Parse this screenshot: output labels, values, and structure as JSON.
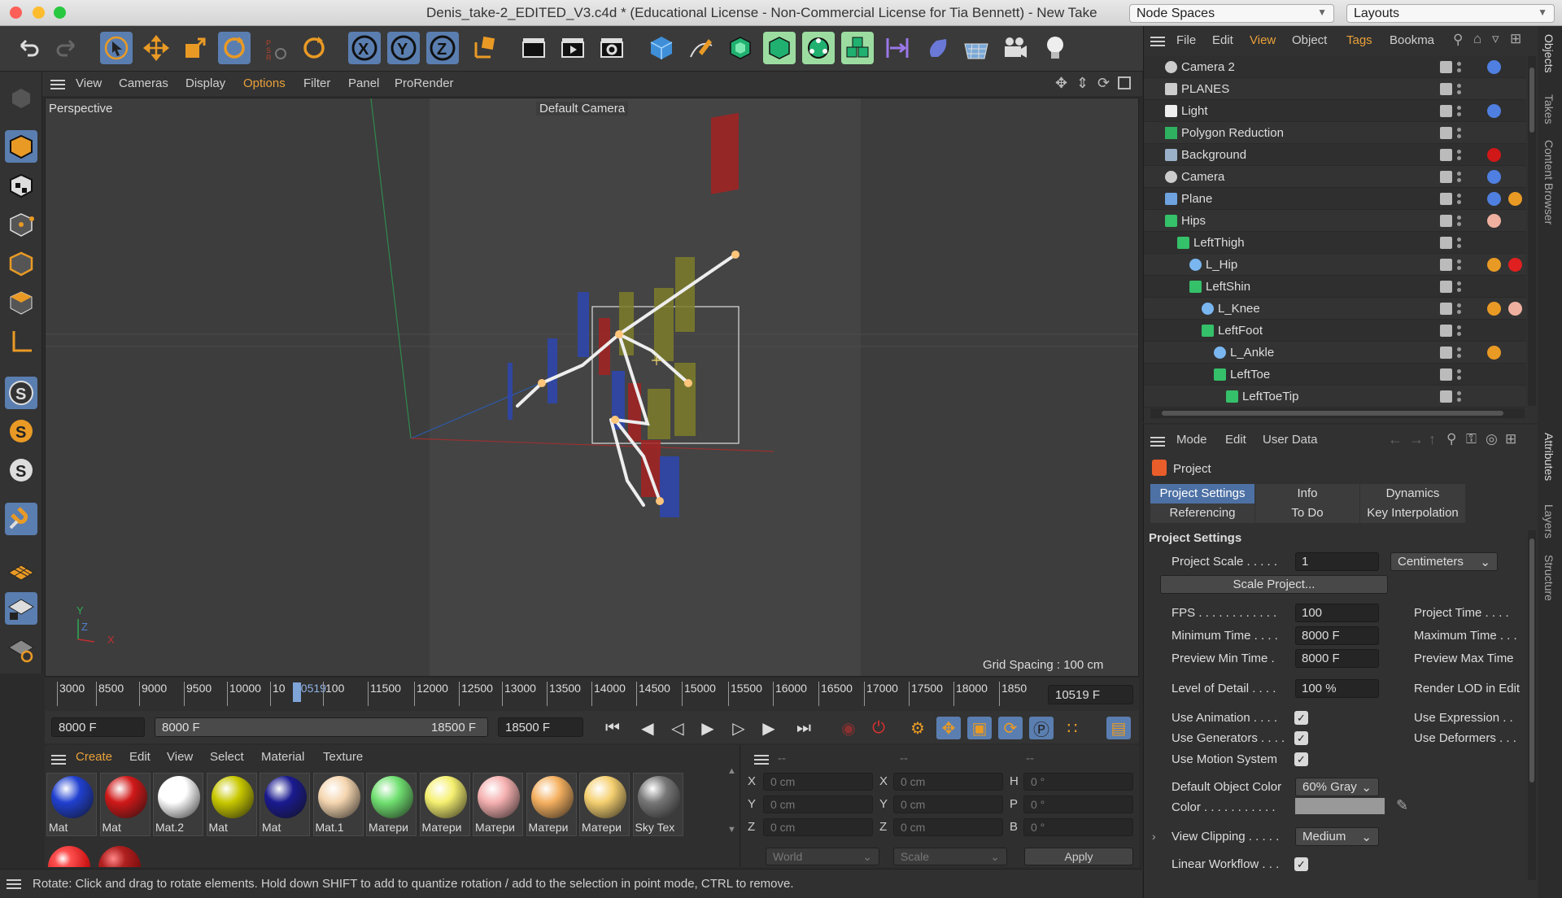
{
  "window": {
    "title": "Denis_take-2_EDITED_V3.c4d * (Educational License - Non-Commercial License for Tia Bennett) - New Take",
    "node_spaces": "Node Spaces",
    "layouts": "Layouts"
  },
  "viewport_menu": {
    "items": [
      "View",
      "Cameras",
      "Display",
      "Options",
      "Filter",
      "Panel",
      "ProRender"
    ],
    "active": "Options"
  },
  "viewport": {
    "label": "Perspective",
    "camera": "Default Camera",
    "grid_spacing": "Grid Spacing : 100 cm",
    "axis": {
      "x": "X",
      "y": "Y",
      "z": "Z"
    }
  },
  "timeline": {
    "ticks": [
      "3000",
      "8500",
      "9000",
      "9500",
      "10000",
      "10",
      "10519",
      "100",
      "11500",
      "12000",
      "12500",
      "13000",
      "13500",
      "14000",
      "14500",
      "15000",
      "15500",
      "16000",
      "16500",
      "17000",
      "17500",
      "18000",
      "1850"
    ],
    "current": "10519 F"
  },
  "playbar": {
    "start": "8000 F",
    "range_start": "8000 F",
    "range_end": "18500 F",
    "end": "18500 F"
  },
  "material_menu": {
    "items": [
      "Create",
      "Edit",
      "View",
      "Select",
      "Material",
      "Texture"
    ],
    "active": "Create"
  },
  "materials": [
    {
      "name": "Mat",
      "color": "#2040d0"
    },
    {
      "name": "Mat",
      "color": "#d01818"
    },
    {
      "name": "Mat.2",
      "color": "#ffffff"
    },
    {
      "name": "Mat",
      "color": "#c8c800"
    },
    {
      "name": "Mat",
      "color": "#1a1a90"
    },
    {
      "name": "Mat.1",
      "color": "#f5d6b0"
    },
    {
      "name": "Матери",
      "color": "#70e070"
    },
    {
      "name": "Матери",
      "color": "#f5f070"
    },
    {
      "name": "Матери",
      "color": "#f5b0b0"
    },
    {
      "name": "Матери",
      "color": "#f5b060"
    },
    {
      "name": "Матери",
      "color": "#f5d070"
    },
    {
      "name": "Sky Tex",
      "color": "#777777"
    }
  ],
  "coords": {
    "header": [
      "--",
      "--",
      "--"
    ],
    "rows": [
      {
        "a": "X",
        "av": "0 cm",
        "b": "X",
        "bv": "0 cm",
        "c": "H",
        "cv": "0 °"
      },
      {
        "a": "Y",
        "av": "0 cm",
        "b": "Y",
        "bv": "0 cm",
        "c": "P",
        "cv": "0 °"
      },
      {
        "a": "Z",
        "av": "0 cm",
        "b": "Z",
        "bv": "0 cm",
        "c": "B",
        "cv": "0 °"
      }
    ],
    "world": "World",
    "scale": "Scale",
    "apply": "Apply"
  },
  "status": "Rotate: Click and drag to rotate elements. Hold down SHIFT to add to quantize rotation / add to the selection in point mode, CTRL to remove.",
  "object_menu": {
    "items": [
      "File",
      "Edit",
      "View",
      "Object",
      "Tags",
      "Bookma"
    ]
  },
  "objects": [
    {
      "name": "Camera 2",
      "depth": 0
    },
    {
      "name": "PLANES",
      "depth": 0
    },
    {
      "name": "Light",
      "depth": 0
    },
    {
      "name": "Polygon Reduction",
      "depth": 0
    },
    {
      "name": "Background",
      "depth": 0
    },
    {
      "name": "Camera",
      "depth": 0
    },
    {
      "name": "Plane",
      "depth": 0
    },
    {
      "name": "Hips",
      "depth": 0
    },
    {
      "name": "LeftThigh",
      "depth": 1
    },
    {
      "name": "L_Hip",
      "depth": 2
    },
    {
      "name": "LeftShin",
      "depth": 2
    },
    {
      "name": "L_Knee",
      "depth": 3
    },
    {
      "name": "LeftFoot",
      "depth": 3
    },
    {
      "name": "L_Ankle",
      "depth": 4
    },
    {
      "name": "LeftToe",
      "depth": 4
    },
    {
      "name": "LeftToeTip",
      "depth": 5
    }
  ],
  "attr_menu": {
    "items": [
      "Mode",
      "Edit",
      "User Data"
    ]
  },
  "attributes": {
    "heading": "Project",
    "tabs": [
      "Project Settings",
      "Info",
      "Dynamics",
      "Referencing",
      "To Do",
      "Key Interpolation"
    ],
    "section": "Project Settings",
    "project_scale_label": "Project Scale . . . . .",
    "project_scale": "1",
    "units": "Centimeters",
    "scale_project": "Scale Project...",
    "fps_label": "FPS . . . . . . . . . . . .",
    "fps": "100",
    "project_time": "Project Time . . . .",
    "min_time_label": "Minimum Time . . . .",
    "min_time": "8000 F",
    "max_time": "Maximum Time . . .",
    "prev_min_label": "Preview Min Time .",
    "prev_min": "8000 F",
    "prev_max": "Preview Max Time",
    "lod_label": "Level of Detail . . . .",
    "lod": "100 %",
    "render_lod": "Render LOD in Edit",
    "use_animation": "Use Animation . . . .",
    "use_expression": "Use Expression . .",
    "use_generators": "Use Generators . . . .",
    "use_deformers": "Use Deformers . . .",
    "use_motion": "Use Motion System",
    "default_color_label": "Default Object Color",
    "default_color": "60% Gray",
    "color_label": "Color . . . . . . . . . . .",
    "view_clipping_label": "View Clipping . . . . .",
    "view_clipping": "Medium",
    "linear_workflow": "Linear Workflow . . ."
  },
  "side_tabs": [
    "Objects",
    "Takes",
    "Content Browser",
    "Attributes",
    "Layers",
    "Structure"
  ]
}
